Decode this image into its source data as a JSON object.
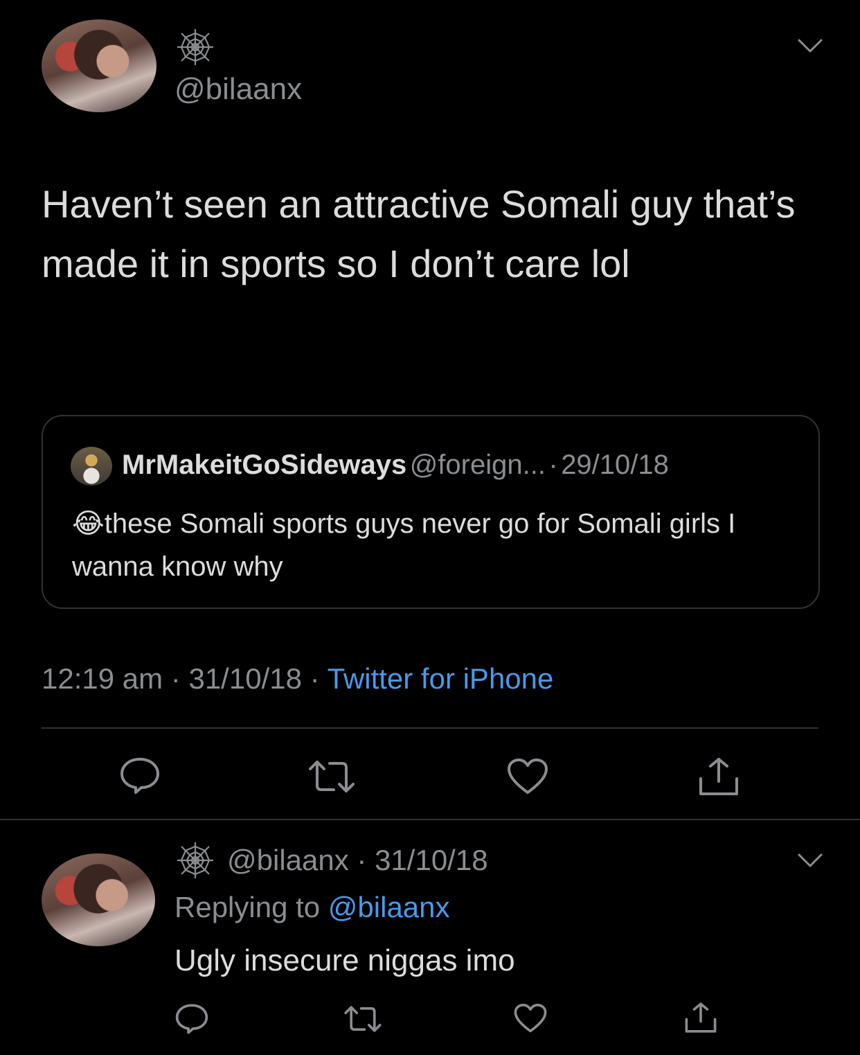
{
  "colors": {
    "background": "#000000",
    "text": "#dcdcdc",
    "muted": "#8a8d91",
    "link": "#4a99e9",
    "border": "#2f3336"
  },
  "main_tweet": {
    "handle": "@bilaanx",
    "name_icon": "spider-web-icon",
    "text": "Haven’t seen an attractive Somali guy that’s made it in sports so I don’t care lol",
    "quoted": {
      "name": "MrMakeitGoSideways",
      "handle": "@foreign...",
      "separator": "·",
      "date": "29/10/18",
      "emoji": "😂",
      "text": "these Somali sports guys never go for Somali girls I wanna know why"
    },
    "meta": {
      "time": "12:19 am",
      "sep1": "·",
      "date": "31/10/18",
      "sep2": "·",
      "source": "Twitter for iPhone"
    },
    "actions": [
      "reply-icon",
      "retweet-icon",
      "like-icon",
      "share-icon"
    ]
  },
  "reply_tweet": {
    "handle": "@bilaanx",
    "separator": "·",
    "date": "31/10/18",
    "replying_prefix": "Replying to",
    "replying_handle": "@bilaanx",
    "text": "Ugly insecure niggas imo",
    "actions": [
      "reply-icon",
      "retweet-icon",
      "like-icon",
      "share-icon"
    ]
  }
}
